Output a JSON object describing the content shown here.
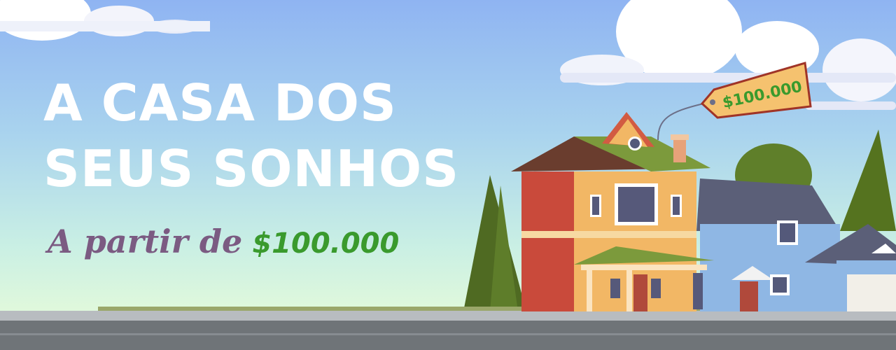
{
  "headline": {
    "line1": "A CASA DOS",
    "line2": "SEUS SONHOS"
  },
  "subline": {
    "lead": "A partir de",
    "price": "$100.000"
  },
  "price_tag": {
    "text": "$100.000"
  },
  "colors": {
    "sky_top": "#8fb4f2",
    "headline": "#ffffff",
    "lead": "#7b5b82",
    "price": "#3a9a2d"
  }
}
